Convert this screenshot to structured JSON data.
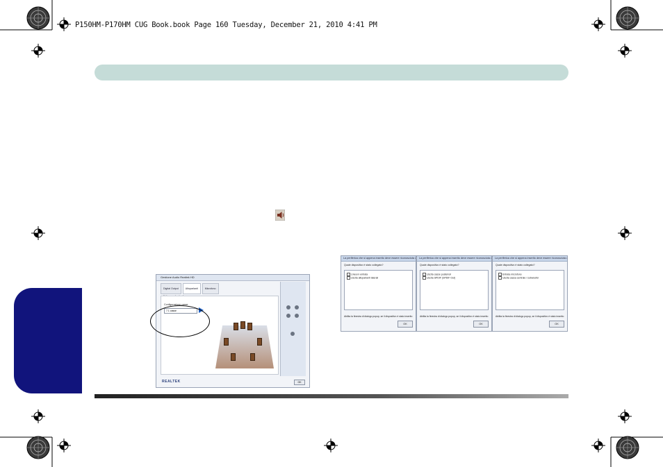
{
  "header": {
    "print_line": "P150HM-P170HM CUG Book.book  Page 160  Tuesday, December 21, 2010  4:41 PM"
  },
  "icons": {
    "speaker": "speaker-icon",
    "registration": "crop-target-icon"
  },
  "colors": {
    "band": "#c5dcd8",
    "side_tab": "#11147c"
  },
  "screenshot_hd": {
    "title": "Gestione Audio Realtek HD",
    "tabs": [
      "Digital Output",
      "Altoparlanti",
      "Microfono"
    ],
    "volume_label": "Volume principale",
    "config_label": "Configurazione casse",
    "select_value": "7.1 casse",
    "brand": "REALTEK",
    "ok": "OK"
  },
  "dialogs": [
    {
      "title": "La periferica che si appena inserito deve essere riconosciuta come:",
      "question": "Quale dispositivo è stato collegato?",
      "items": [
        "Linea in entrata",
        "Uscita altoparlanti laterali"
      ],
      "checkbox": "Abilita la finestra di dialogo popup, se il dispositivo è stato inserito",
      "ok": "OK"
    },
    {
      "title": "La periferica che si appena inserito deve essere riconosciuta come:",
      "question": "Quale dispositivo è stato collegato?",
      "items": [
        "Uscita casse posteriori",
        "Uscita SPDIF (SPDIF Out)"
      ],
      "checkbox": "Abilita la finestra di dialogo popup, se il dispositivo è stato inserito",
      "ok": "OK"
    },
    {
      "title": "La periferica che si appena inserito deve essere riconosciuta come:",
      "question": "Quale dispositivo è stato collegato?",
      "items": [
        "Entrata microfono",
        "Uscita cassa centrale / subwoofer"
      ],
      "checkbox": "Abilita la finestra di dialogo popup, se il dispositivo è stato inserito",
      "ok": "OK"
    }
  ]
}
